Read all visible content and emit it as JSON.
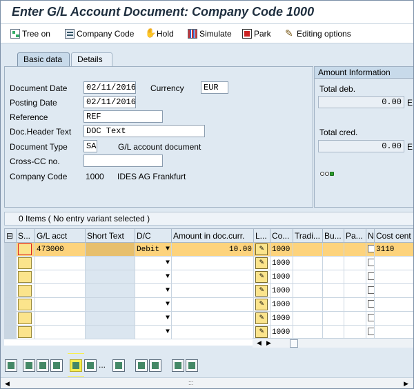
{
  "window": {
    "title": "Enter G/L Account Document: Company Code 1000"
  },
  "toolbar": {
    "tree_on": "Tree on",
    "company_code": "Company Code",
    "hold": "Hold",
    "simulate": "Simulate",
    "park": "Park",
    "editing_options": "Editing options"
  },
  "tabs": [
    {
      "label": "Basic data",
      "active": true
    },
    {
      "label": "Details",
      "active": false
    }
  ],
  "basic_data": {
    "document_date_label": "Document Date",
    "document_date": "02/11/2016",
    "currency_label": "Currency",
    "currency": "EUR",
    "posting_date_label": "Posting Date",
    "posting_date": "02/11/2016",
    "reference_label": "Reference",
    "reference": "REF",
    "doc_header_label": "Doc.Header Text",
    "doc_header": "DOC Text",
    "doc_type_label": "Document Type",
    "doc_type": "SA",
    "doc_type_desc": "G/L account document",
    "cross_cc_label": "Cross-CC no.",
    "cross_cc": "",
    "company_code_label": "Company Code",
    "company_code": "1000",
    "company_name": "IDES AG Frankfurt"
  },
  "amount_info": {
    "header": "Amount Information",
    "total_deb_label": "Total deb.",
    "total_deb": "0.00",
    "total_deb_suffix": "E",
    "total_cred_label": "Total cred.",
    "total_cred": "0.00",
    "total_cred_suffix": "E"
  },
  "items_bar": {
    "text": "0 Items ( No entry variant selected )"
  },
  "grid": {
    "columns": [
      "S...",
      "G/L acct",
      "Short Text",
      "D/C",
      "Amount in doc.curr.",
      "L...",
      "Co...",
      "Tradi...",
      "Bu...",
      "Pa...",
      "N",
      "Cost cent"
    ],
    "rows": [
      {
        "gl": "473000",
        "short": "",
        "dc": "Debit",
        "amount": "10.00",
        "co": "1000",
        "cost": "3110"
      },
      {
        "gl": "",
        "short": "",
        "dc": "",
        "amount": "",
        "co": "1000",
        "cost": ""
      },
      {
        "gl": "",
        "short": "",
        "dc": "",
        "amount": "",
        "co": "1000",
        "cost": ""
      },
      {
        "gl": "",
        "short": "",
        "dc": "",
        "amount": "",
        "co": "1000",
        "cost": ""
      },
      {
        "gl": "",
        "short": "",
        "dc": "",
        "amount": "",
        "co": "1000",
        "cost": ""
      },
      {
        "gl": "",
        "short": "",
        "dc": "",
        "amount": "",
        "co": "1000",
        "cost": ""
      },
      {
        "gl": "",
        "short": "",
        "dc": "",
        "amount": "",
        "co": "1000",
        "cost": ""
      }
    ]
  },
  "bottom_toolbar": {
    "more": "..."
  },
  "icons": {
    "tree": "tree-icon",
    "company": "company-code-icon",
    "hold": "hold-icon",
    "simulate": "simulate-icon",
    "park": "park-icon",
    "edit": "pencil-icon"
  },
  "colors": {
    "active_row": "#fdd37c",
    "status_yellow": "#fbe48c",
    "panel_bg": "#dfe9f2",
    "highlight": "#f7ef50"
  }
}
